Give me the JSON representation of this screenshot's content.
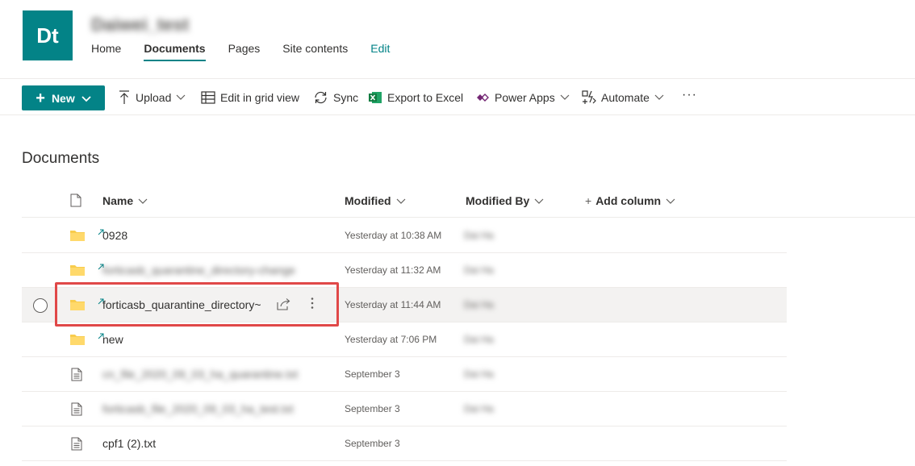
{
  "site": {
    "logo_text": "Dt",
    "title": "Daiwei_test",
    "nav": [
      {
        "label": "Home"
      },
      {
        "label": "Documents"
      },
      {
        "label": "Pages"
      },
      {
        "label": "Site contents"
      },
      {
        "label": "Edit"
      }
    ]
  },
  "command_bar": {
    "new_label": "New",
    "upload_label": "Upload",
    "grid_label": "Edit in grid view",
    "sync_label": "Sync",
    "export_label": "Export to Excel",
    "powerapps_label": "Power Apps",
    "automate_label": "Automate",
    "more_label": "···"
  },
  "library": {
    "title": "Documents",
    "columns": {
      "name": "Name",
      "modified": "Modified",
      "modified_by": "Modified By",
      "add_column": "Add column"
    },
    "rows": [
      {
        "type": "folder",
        "name": "0928",
        "modified": "Yesterday at 10:38 AM",
        "modified_by": "Dai Ha"
      },
      {
        "type": "folder",
        "name": "forticasb_quarantine_directory-change",
        "modified": "Yesterday at 11:32 AM",
        "modified_by": "Dai Ha"
      },
      {
        "type": "folder",
        "name": "forticasb_quarantine_directory~",
        "modified": "Yesterday at 11:44 AM",
        "modified_by": "Dai Ha"
      },
      {
        "type": "folder",
        "name": "new",
        "modified": "Yesterday at 7:06 PM",
        "modified_by": "Dai Ha"
      },
      {
        "type": "file",
        "name": "cn_file_2020_09_03_ha_quarantine.txt",
        "modified": "September 3",
        "modified_by": "Dai Ha"
      },
      {
        "type": "file",
        "name": "forticasb_file_2020_09_03_ha_test.txt",
        "modified": "September 3",
        "modified_by": "Dai Ha"
      },
      {
        "type": "file",
        "name": "cpf1 (2).txt",
        "modified": "September 3",
        "modified_by": ""
      }
    ]
  },
  "colors": {
    "brand": "#038387",
    "highlight": "#e04848",
    "folder": "#f8cc4d",
    "excel": "#107c41"
  },
  "icons": [
    "plus-icon",
    "chevron-down-icon",
    "upload-icon",
    "grid-icon",
    "sync-icon",
    "excel-icon",
    "power-apps-icon",
    "automate-icon",
    "more-icon",
    "file-type-icon",
    "folder-icon",
    "document-icon",
    "share-icon",
    "new-item-icon"
  ]
}
